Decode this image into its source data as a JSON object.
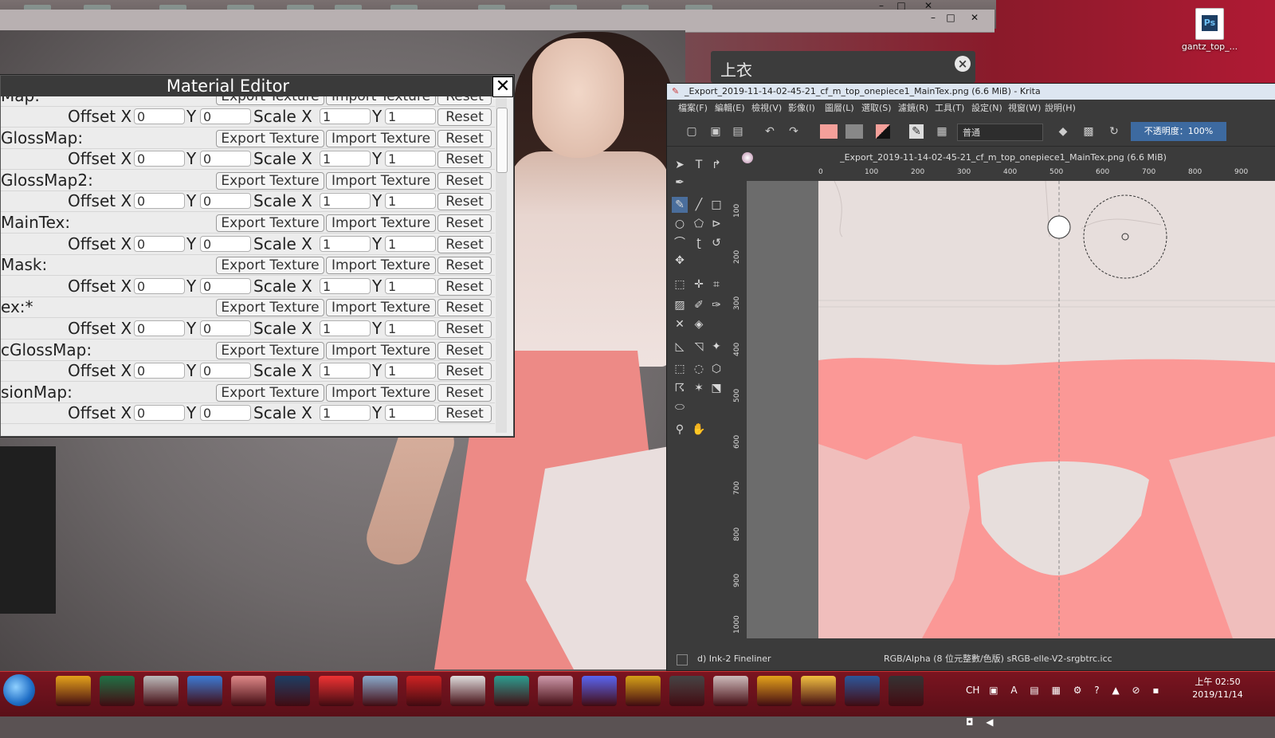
{
  "desktop": {
    "file_icon_label": "gantz_top_...",
    "file_icon_text": "Ps"
  },
  "top_dialog": {
    "title": "上衣",
    "close_label": "×"
  },
  "material_editor": {
    "title": "Material Editor",
    "close_label": "✕",
    "export_label": "Export Texture",
    "import_label": "Import Texture",
    "reset_label": "Reset",
    "offset_x_label": "Offset X",
    "y_label": "Y",
    "scale_x_label": "Scale X",
    "partial_top_row": "Map:",
    "maps": [
      {
        "name": "",
        "offset_x": "0",
        "offset_y": "0",
        "scale_x": "1",
        "scale_y": "1"
      },
      {
        "name": "GlossMap:",
        "offset_x": "0",
        "offset_y": "0",
        "scale_x": "1",
        "scale_y": "1"
      },
      {
        "name": "GlossMap2:",
        "offset_x": "0",
        "offset_y": "0",
        "scale_x": "1",
        "scale_y": "1"
      },
      {
        "name": "MainTex:",
        "offset_x": "0",
        "offset_y": "0",
        "scale_x": "1",
        "scale_y": "1"
      },
      {
        "name": "Mask:",
        "offset_x": "0",
        "offset_y": "0",
        "scale_x": "1",
        "scale_y": "1"
      },
      {
        "name": "ex:*",
        "offset_x": "0",
        "offset_y": "0",
        "scale_x": "1",
        "scale_y": "1"
      },
      {
        "name": "cGlossMap:",
        "offset_x": "0",
        "offset_y": "0",
        "scale_x": "1",
        "scale_y": "1"
      },
      {
        "name": "sionMap:",
        "offset_x": "0",
        "offset_y": "0",
        "scale_x": "1",
        "scale_y": "1"
      }
    ]
  },
  "krita": {
    "title": "_Export_2019-11-14-02-45-21_cf_m_top_onepiece1_MainTex.png (6.6 MiB) - Krita",
    "menu": [
      "檔案(F)",
      "編輯(E)",
      "檢視(V)",
      "影像(I)",
      "圖層(L)",
      "選取(S)",
      "濾鏡(R)",
      "工具(T)",
      "設定(N)",
      "視窗(W)",
      "說明(H)"
    ],
    "blend_mode": "普通",
    "opacity": "不透明度：100%",
    "doc_tab": "_Export_2019-11-14-02-45-21_cf_m_top_onepiece1_MainTex.png (6.6 MiB)",
    "ruler_h": [
      "0",
      "100",
      "200",
      "300",
      "400",
      "500",
      "600",
      "700",
      "800",
      "900"
    ],
    "ruler_v": [
      "100",
      "200",
      "300",
      "400",
      "500",
      "600",
      "700",
      "800",
      "900",
      "1000"
    ],
    "brush_preset": "d) Ink-2 Fineliner",
    "color_profile": "RGB/Alpha (8 位元整數/色版)  sRGB-elle-V2-srgbtrc.icc",
    "colors": {
      "fg": "#f4a09a",
      "bg": "#888888",
      "canvas": "#e7dedc",
      "pattern": "#fb9896"
    }
  },
  "taskbar": {
    "apps": [
      "chrome",
      "excel",
      "network",
      "paint",
      "brush",
      "Ps",
      "pdf",
      "notes",
      "spm",
      "zbrush",
      "3ds",
      "krita",
      "discord",
      "lines",
      "char1",
      "char2",
      "chrome2",
      "folder",
      "word",
      "char3"
    ],
    "tray_lang": "CH",
    "clock_time": "上午 02:50",
    "clock_date": "2019/11/14"
  }
}
